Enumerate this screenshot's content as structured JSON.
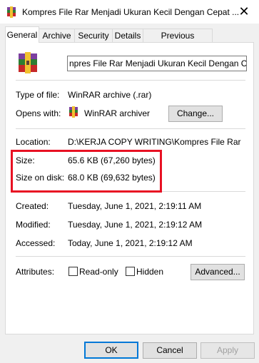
{
  "window": {
    "title": "Kompres File Rar Menjadi Ukuran Kecil Dengan Cepat ...",
    "close_glyph": "✕"
  },
  "tabs": [
    {
      "label": "General"
    },
    {
      "label": "Archive"
    },
    {
      "label": "Security"
    },
    {
      "label": "Details"
    },
    {
      "label": "Previous Versions"
    }
  ],
  "file": {
    "name_field_value": "npres File Rar Menjadi Ukuran Kecil Dengan Cepat",
    "type_label": "Type of file:",
    "type_value": "WinRAR archive (.rar)",
    "opens_with_label": "Opens with:",
    "opens_with_value": "WinRAR archiver",
    "change_button": "Change...",
    "location_label": "Location:",
    "location_value": "D:\\KERJA COPY WRITING\\Kompres File Rar Menja",
    "size_label": "Size:",
    "size_value": "65.6 KB (67,260 bytes)",
    "size_on_disk_label": "Size on disk:",
    "size_on_disk_value": "68.0 KB (69,632 bytes)",
    "created_label": "Created:",
    "created_value": "Tuesday, June 1, 2021, 2:19:11 AM",
    "modified_label": "Modified:",
    "modified_value": "Tuesday, June 1, 2021, 2:19:12 AM",
    "accessed_label": "Accessed:",
    "accessed_value": "Today, June 1, 2021, 2:19:12 AM",
    "attributes_label": "Attributes:",
    "readonly_label": "Read-only",
    "hidden_label": "Hidden",
    "advanced_button": "Advanced..."
  },
  "footer": {
    "ok": "OK",
    "cancel": "Cancel",
    "apply": "Apply"
  },
  "colors": {
    "highlight": "#e81123",
    "accent": "#0078d7"
  }
}
